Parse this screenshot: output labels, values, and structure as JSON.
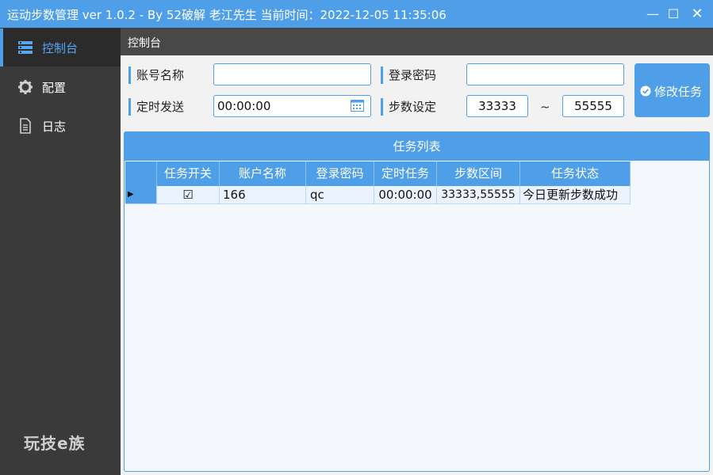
{
  "window": {
    "title": "运动步数管理 ver 1.0.2 - By 52破解 老江先生 当前时间：2022-12-05 11:35:06",
    "min_glyph": "—",
    "max_glyph": "☐",
    "close_glyph": "✕"
  },
  "sidebar": {
    "items": [
      {
        "label": "控制台",
        "icon": "console-icon",
        "active": true
      },
      {
        "label": "配置",
        "icon": "gear-icon",
        "active": false
      },
      {
        "label": "日志",
        "icon": "document-icon",
        "active": false
      }
    ],
    "logo_text": "玩技e族"
  },
  "header": {
    "title": "控制台"
  },
  "form": {
    "account_label": "账号名称",
    "account_value": "",
    "password_label": "登录密码",
    "password_value": "",
    "schedule_label": "定时发送",
    "schedule_value": "00:00:00",
    "steps_label": "步数设定",
    "steps_min": "33333",
    "steps_separator": "~",
    "steps_max": "55555",
    "modify_button": "修改任务"
  },
  "task_list": {
    "title": "任务列表",
    "columns": [
      "任务开关",
      "账户名称",
      "登录密码",
      "定时任务",
      "步数区间",
      "任务状态"
    ],
    "rows": [
      {
        "selector": "▶",
        "enabled": "☑",
        "account": "166",
        "password": "qc",
        "schedule": "00:00:00",
        "step_range": "33333,55555",
        "status": "今日更新步数成功"
      }
    ]
  },
  "colors": {
    "accent": "#4e9ee8",
    "sidebar_bg": "#3a3a3a",
    "header_bg": "#484848"
  }
}
